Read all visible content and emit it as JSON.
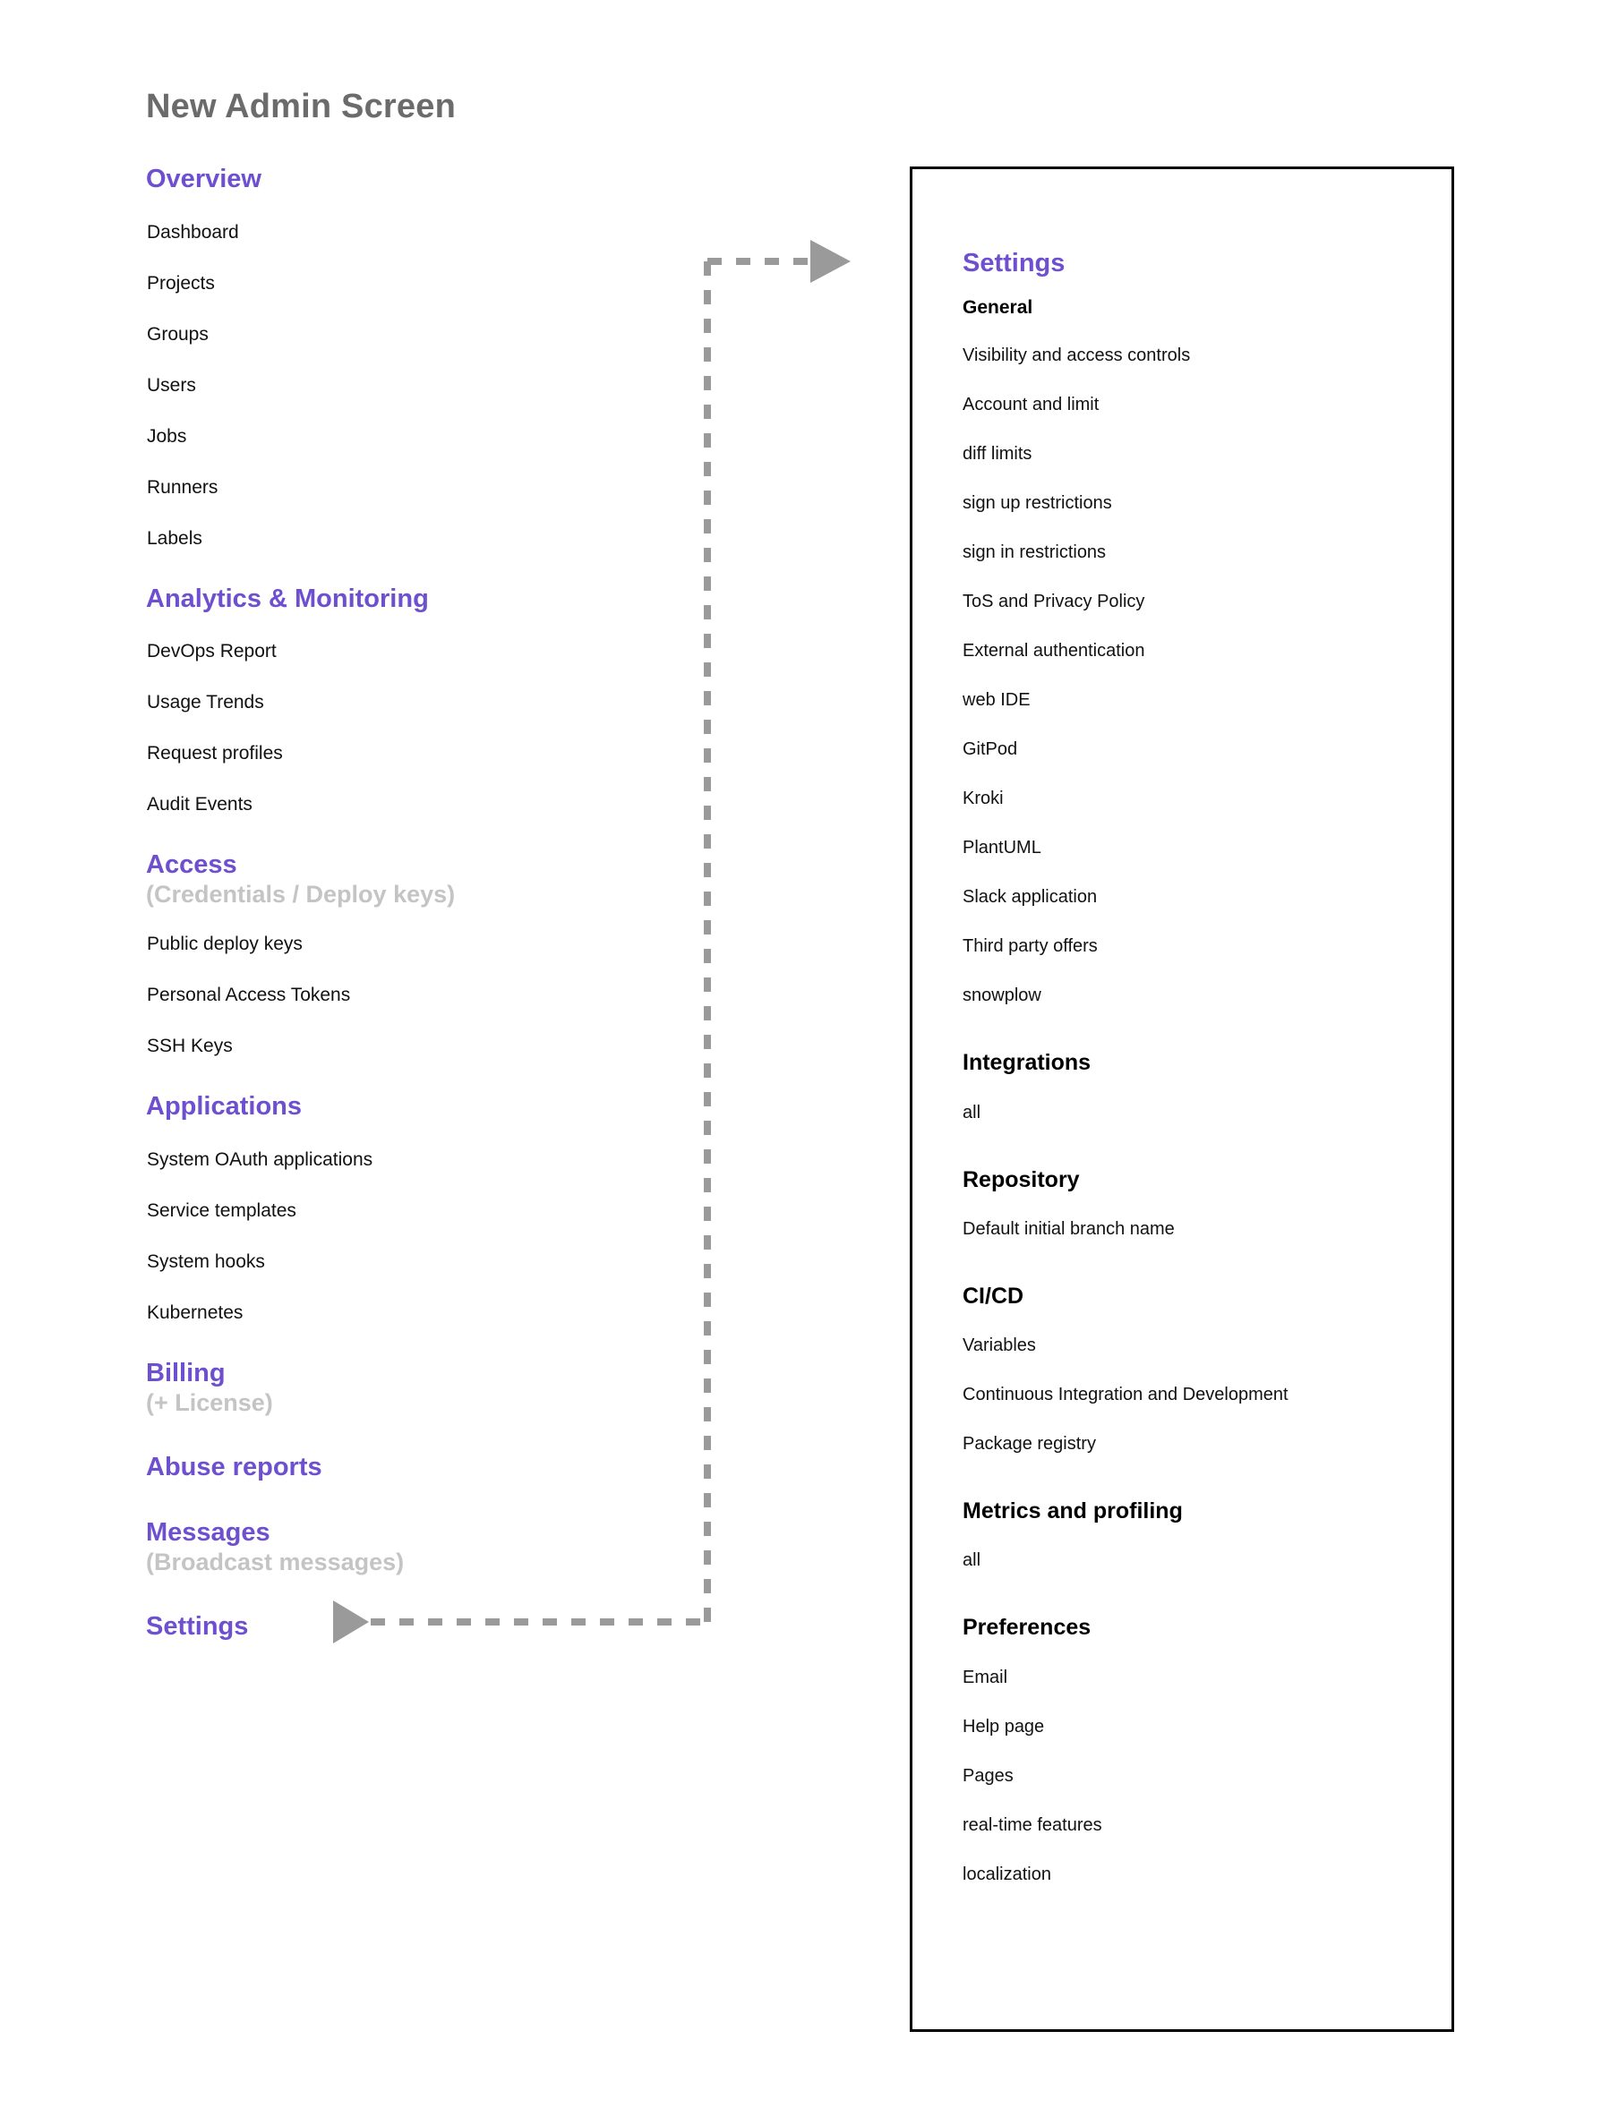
{
  "page": {
    "title": "New Admin Screen",
    "accent_purple": "#6d4fd0",
    "muted_gray": "#c4c4c4",
    "title_gray": "#6b6b6b",
    "connector_gray": "#9a9a9a",
    "panel_border": "#000000"
  },
  "nav": {
    "groups": [
      {
        "heading": "Overview",
        "subheading": "",
        "items": [
          "Dashboard",
          "Projects",
          "Groups",
          "Users",
          "Jobs",
          "Runners",
          "Labels"
        ]
      },
      {
        "heading": "Analytics & Monitoring",
        "subheading": "",
        "items": [
          "DevOps Report",
          "Usage Trends",
          "Request profiles",
          "Audit Events"
        ]
      },
      {
        "heading": "Access",
        "subheading": "(Credentials / Deploy keys)",
        "items": [
          "Public deploy keys",
          "Personal Access Tokens",
          "SSH Keys"
        ]
      },
      {
        "heading": "Applications",
        "subheading": "",
        "items": [
          "System OAuth applications",
          "Service templates",
          "System hooks",
          "Kubernetes"
        ]
      },
      {
        "heading": "Billing",
        "subheading": "(+ License)",
        "items": []
      },
      {
        "heading": "Abuse reports",
        "subheading": "",
        "items": []
      },
      {
        "heading": "Messages",
        "subheading": "(Broadcast messages)",
        "items": []
      },
      {
        "heading": "Settings",
        "subheading": "",
        "items": []
      }
    ]
  },
  "settings_panel": {
    "title": "Settings",
    "sections": [
      {
        "heading": "General",
        "items": [
          "Visibility and access controls",
          "Account and limit",
          "diff limits",
          "sign up restrictions",
          "sign in restrictions",
          "ToS and Privacy Policy",
          "External authentication",
          "web IDE",
          "GitPod",
          "Kroki",
          "PlantUML",
          "Slack application",
          "Third party offers",
          "snowplow"
        ]
      },
      {
        "heading": "Integrations",
        "items": [
          "all"
        ]
      },
      {
        "heading": "Repository",
        "items": [
          "Default initial branch name"
        ]
      },
      {
        "heading": "CI/CD",
        "items": [
          "Variables",
          "Continuous Integration and Development",
          "Package registry"
        ]
      },
      {
        "heading": "Metrics and profiling",
        "items": [
          "all"
        ]
      },
      {
        "heading": "Preferences",
        "items": [
          "Email",
          "Help page",
          "Pages",
          "real-time features",
          "localization"
        ]
      }
    ]
  },
  "connector": {
    "label": "settings-link",
    "style": "dashed-elbow",
    "arrow_top": "arrow-right",
    "arrow_bottom": "arrow-left"
  }
}
